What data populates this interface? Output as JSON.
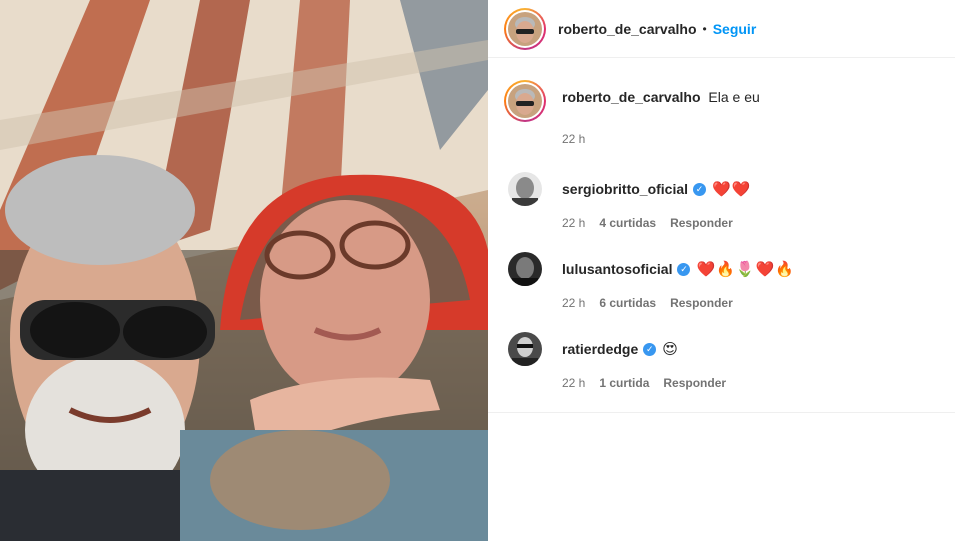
{
  "post": {
    "author": "roberto_de_carvalho",
    "follow_separator": "•",
    "follow_label": "Seguir",
    "caption_user": "roberto_de_carvalho",
    "caption_text": "Ela e eu",
    "caption_time": "22 h"
  },
  "comments": [
    {
      "user": "sergiobritto_oficial",
      "verified": true,
      "text": "❤️❤️",
      "time": "22 h",
      "likes": "4 curtidas",
      "reply": "Responder"
    },
    {
      "user": "lulusantosoficial",
      "verified": true,
      "text": "❤️🔥🌷❤️🔥",
      "time": "22 h",
      "likes": "6 curtidas",
      "reply": "Responder"
    },
    {
      "user": "ratierdedge",
      "verified": true,
      "text": "😍",
      "time": "22 h",
      "likes": "1 curtida",
      "reply": "Responder"
    }
  ],
  "colors": {
    "accent": "#0095f6",
    "verified": "#3897f0",
    "muted": "#737373"
  }
}
